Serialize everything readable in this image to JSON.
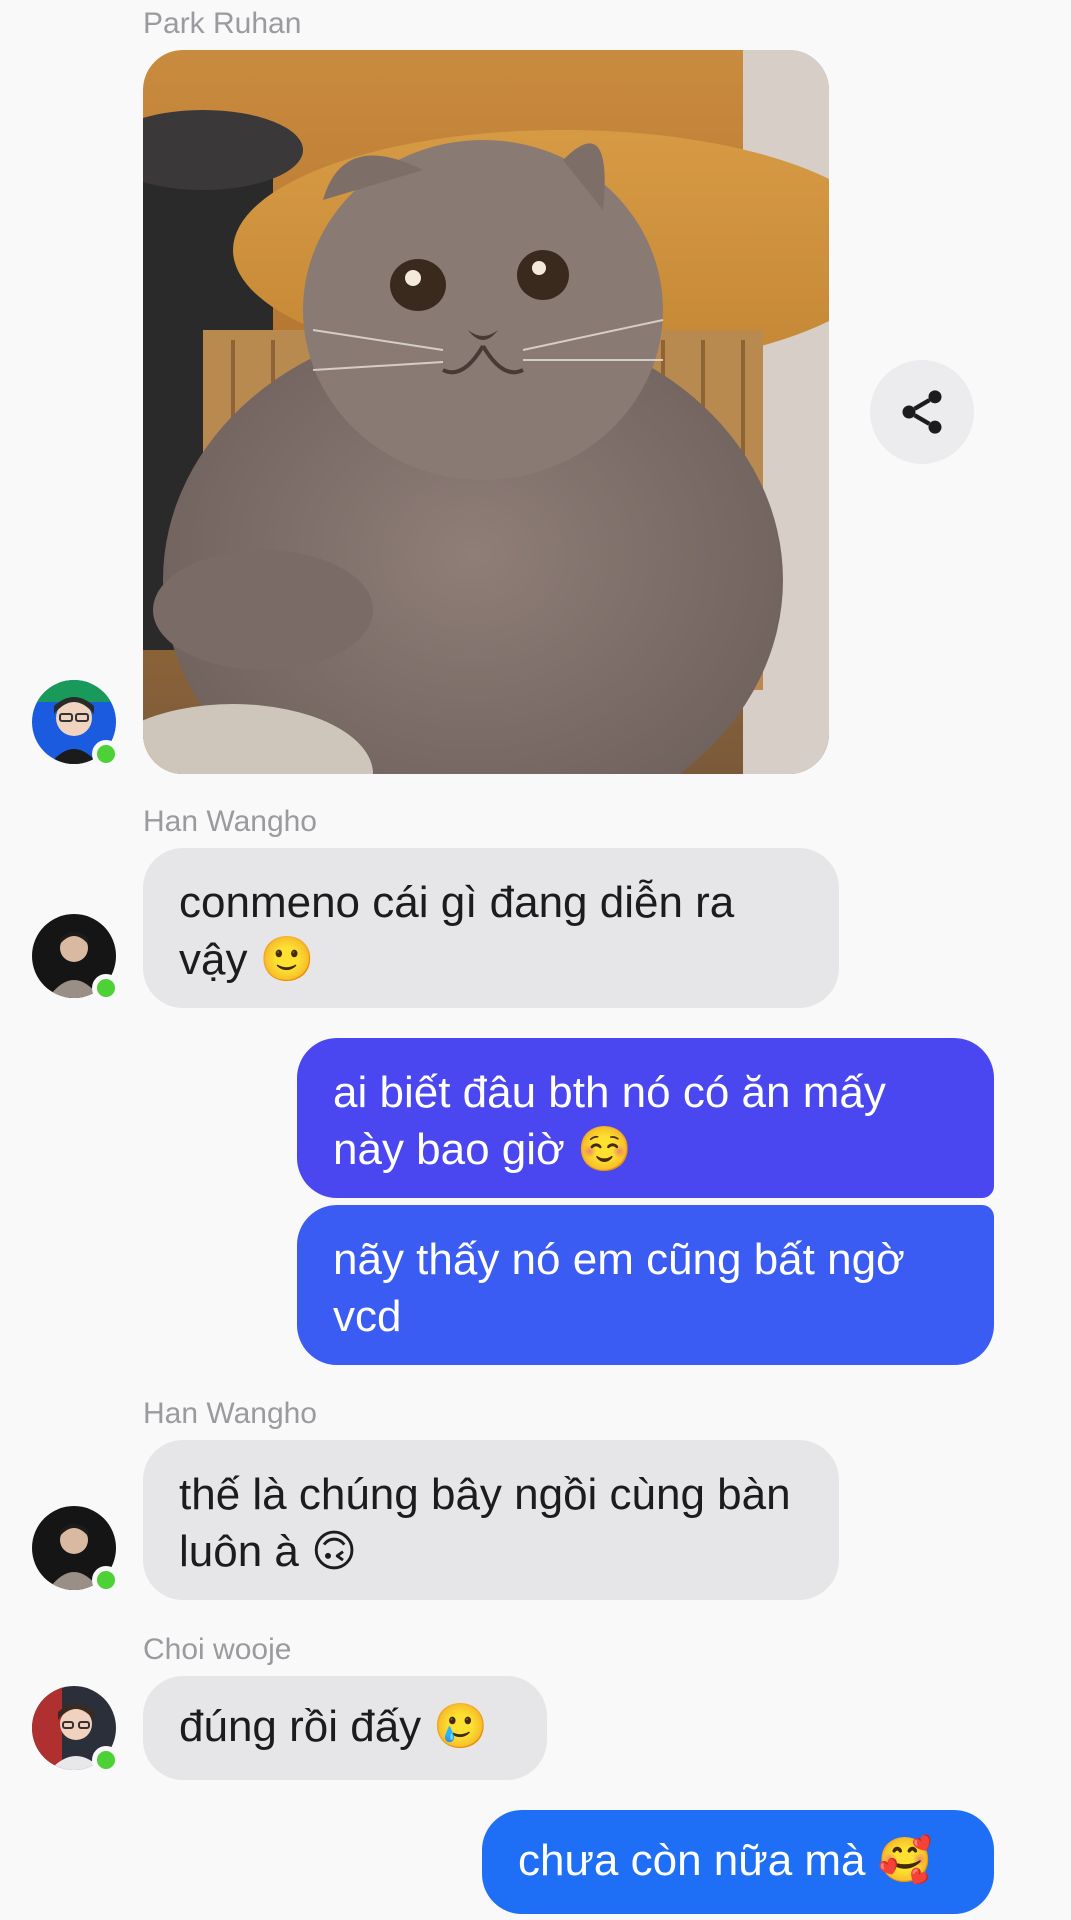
{
  "messages": [
    {
      "sender": "Park Ruhan",
      "type": "image",
      "image_alt": "gray cat with wide eyes next to wooden table"
    },
    {
      "sender": "Han Wangho",
      "text": "conmeno cái gì đang diễn ra vậy 🙂"
    },
    {
      "sender": "me",
      "text": "ai biết đâu bth nó có ăn mấy này bao giờ ☺️"
    },
    {
      "sender": "me",
      "text": "nãy thấy nó em cũng bất ngờ vcd"
    },
    {
      "sender": "Han Wangho",
      "text": "thế là chúng bây ngồi cùng bàn luôn à 🙃"
    },
    {
      "sender": "Choi wooje",
      "text": "đúng rồi đấy 🥲"
    },
    {
      "sender": "me",
      "text": "chưa còn nữa mà 🥰"
    }
  ],
  "icons": {
    "share": "share-icon"
  },
  "colors": {
    "incoming_bubble": "#e6e6e8",
    "outgoing_top": "#4a47f0",
    "outgoing_mid": "#3a5cf2",
    "outgoing_bottom": "#1e6ff5",
    "online": "#4cd137",
    "name_gray": "#9a9a9f"
  }
}
